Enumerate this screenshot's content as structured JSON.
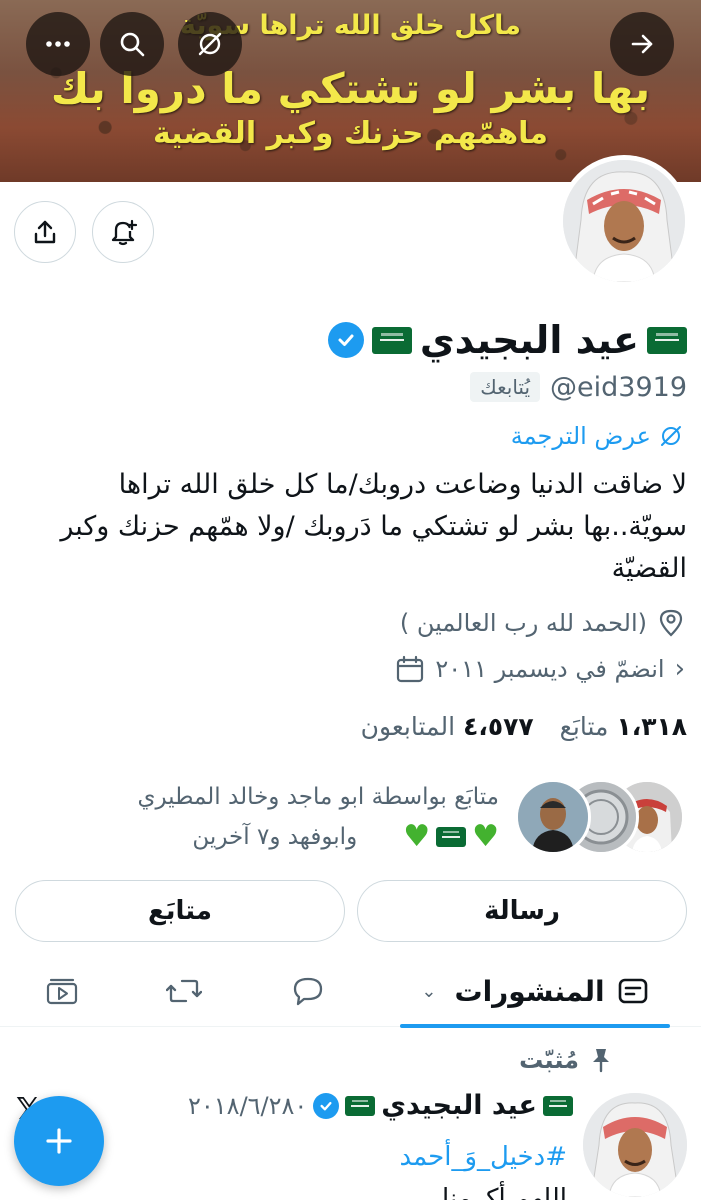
{
  "banner": {
    "line1": "ماكل خلق الله تراها سويّة",
    "line2": "بها بشر لو تشتكي ما دروا بك",
    "line3": "ماهمّهم حزنك وكبر القضية"
  },
  "profile": {
    "name": "عيد البجيدي",
    "handle": "@eid3919",
    "follows_you": "يُتابعك",
    "translate": "عرض الترجمة",
    "bio": "لا ضاقت الدنيا وضاعت دروبك/ما كل خلق الله تراها سويّة..بها بشر لو تشتكي ما دَروبك /ولا همّهم حزنك وكبر القضيّة",
    "location": "(الحمد لله رب العالمين )",
    "joined": "انضمّ في ديسمبر ٢٠١١",
    "following_count": "١،٣١٨",
    "following_label": "متابَع",
    "followers_count": "٤،٥٧٧",
    "followers_label": "المتابعون",
    "followed_by_line1": "متابَع بواسطة ابو ماجد وخالد المطيري",
    "followed_by_line2": "وابوفهد و٧ آخرين"
  },
  "buttons": {
    "message": "رسالة",
    "following": "متابَع"
  },
  "tabs": {
    "posts": "المنشورات"
  },
  "post": {
    "pinned_label": "مُثبّت",
    "author": "عيد البجيدي",
    "date": "٢٠١٨/٦/٢٨٠",
    "hashtag": "#دخيل_وَ_أحمد",
    "text_start": "اللهم أكرمنا"
  },
  "colors": {
    "accent": "#1d9bf0",
    "text": "#0f1419",
    "muted": "#536471",
    "border": "#cfd9de"
  },
  "icons": {
    "more": "more-icon",
    "search": "search-icon",
    "translate": "translate-off-icon",
    "forward": "arrow-right-icon",
    "share": "share-icon",
    "bell": "bell-plus-icon",
    "location": "location-icon",
    "calendar": "calendar-icon",
    "posts_tab": "posts-icon",
    "replies_tab": "reply-icon",
    "reposts_tab": "repost-icon",
    "media_tab": "video-icon",
    "pin": "pin-icon",
    "compose": "plus-icon"
  }
}
